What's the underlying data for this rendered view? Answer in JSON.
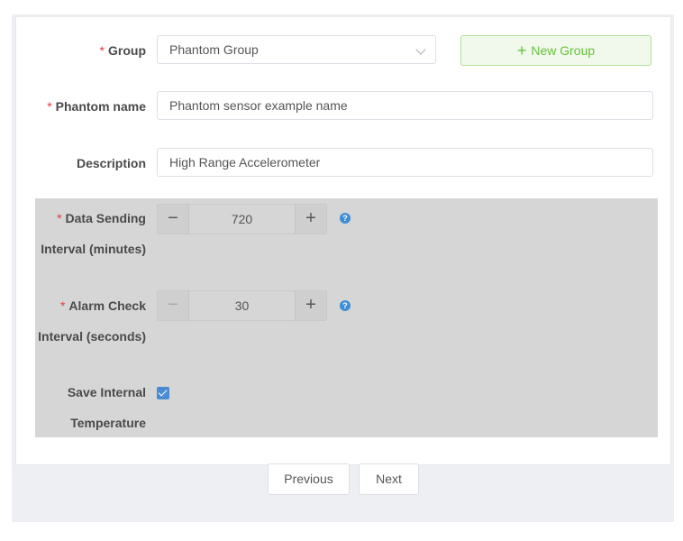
{
  "form": {
    "group": {
      "label": "Group",
      "required_mark": "*",
      "value": "Phantom Group",
      "icon": "chevron-down-icon"
    },
    "new_group_button": {
      "label": "New Group",
      "icon_glyph": "+"
    },
    "phantom_name": {
      "label": "Phantom name",
      "required_mark": "*",
      "value": "Phantom sensor example name"
    },
    "description": {
      "label": "Description",
      "value": "High Range Accelerometer"
    },
    "data_sending_interval": {
      "label_line1": "Data Sending",
      "label_line2": "Interval (minutes)",
      "required_mark": "*",
      "value": "720",
      "minus_glyph": "−",
      "plus_glyph": "+",
      "help_glyph": "?"
    },
    "alarm_check_interval": {
      "label_line1": "Alarm Check",
      "label_line2": "Interval (seconds)",
      "required_mark": "*",
      "value": "30",
      "minus_glyph": "−",
      "plus_glyph": "+",
      "help_glyph": "?"
    },
    "save_internal_temperature": {
      "label_line1": "Save Internal",
      "label_line2": "Temperature",
      "checked": true
    }
  },
  "footer": {
    "previous_label": "Previous",
    "next_label": "Next"
  },
  "colors": {
    "accent_success": "#67c23a",
    "required": "#e4393c",
    "checkbox": "#4a8bd4",
    "help_icon": "#3e8ed6"
  }
}
